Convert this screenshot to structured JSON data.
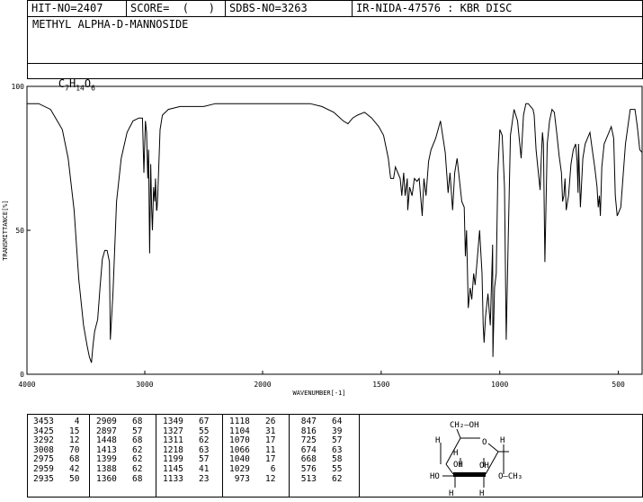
{
  "header": {
    "hit_no": "HIT-NO=2407",
    "score": "SCORE=  (   )",
    "sdbs_no": "SDBS-NO=3263",
    "ir_nida": "IR-NIDA-47576 : KBR DISC"
  },
  "compound_name": "METHYL ALPHA-D-MANNOSIDE",
  "formula": {
    "c": "C",
    "c_n": "7",
    "h": "H",
    "h_n": "14",
    "o": "O",
    "o_n": "6"
  },
  "chart_data": {
    "type": "line",
    "xlabel": "WAVENUMBER[-1]",
    "ylabel": "TRANSMITTANCE[%]",
    "xlim": [
      4000,
      400
    ],
    "ylim": [
      0,
      100
    ],
    "x_ticks": [
      4000,
      3000,
      2000,
      1500,
      1000,
      500
    ],
    "y_ticks": [
      0,
      50,
      100
    ],
    "x": [
      4000,
      3900,
      3800,
      3700,
      3650,
      3600,
      3560,
      3520,
      3490,
      3470,
      3453,
      3440,
      3425,
      3400,
      3380,
      3360,
      3340,
      3320,
      3300,
      3292,
      3270,
      3240,
      3200,
      3150,
      3100,
      3050,
      3020,
      3008,
      2995,
      2985,
      2975,
      2968,
      2959,
      2950,
      2942,
      2935,
      2925,
      2915,
      2909,
      2900,
      2897,
      2890,
      2870,
      2850,
      2800,
      2700,
      2600,
      2500,
      2400,
      2300,
      2200,
      2100,
      2000,
      1900,
      1800,
      1750,
      1700,
      1660,
      1640,
      1620,
      1600,
      1570,
      1540,
      1510,
      1490,
      1470,
      1460,
      1448,
      1440,
      1430,
      1420,
      1413,
      1405,
      1399,
      1390,
      1388,
      1380,
      1370,
      1360,
      1349,
      1340,
      1327,
      1320,
      1311,
      1300,
      1290,
      1270,
      1250,
      1230,
      1218,
      1210,
      1199,
      1190,
      1180,
      1160,
      1150,
      1145,
      1140,
      1133,
      1125,
      1118,
      1110,
      1104,
      1095,
      1085,
      1075,
      1070,
      1066,
      1060,
      1050,
      1040,
      1030,
      1029,
      1022,
      1015,
      1008,
      1000,
      990,
      980,
      973,
      965,
      955,
      940,
      925,
      910,
      900,
      890,
      880,
      870,
      860,
      855,
      847,
      840,
      830,
      825,
      820,
      816,
      810,
      800,
      790,
      780,
      770,
      760,
      750,
      740,
      735,
      730,
      725,
      720,
      710,
      700,
      690,
      680,
      674,
      670,
      668,
      660,
      650,
      640,
      630,
      620,
      610,
      600,
      590,
      585,
      580,
      576,
      570,
      560,
      540,
      530,
      520,
      513,
      505,
      490,
      470,
      450,
      430,
      420,
      410,
      400
    ],
    "y": [
      94,
      94,
      92,
      85,
      75,
      57,
      33,
      17,
      10,
      6,
      4,
      10,
      15,
      19,
      30,
      40,
      43,
      43,
      39,
      12,
      28,
      60,
      75,
      84,
      88,
      89,
      89,
      70,
      88,
      84,
      68,
      78,
      42,
      73,
      58,
      50,
      65,
      60,
      68,
      57,
      57,
      62,
      85,
      90,
      92,
      93,
      93,
      93,
      94,
      94,
      94,
      94,
      94,
      94,
      94,
      93,
      91,
      88,
      87,
      89,
      90,
      91,
      89,
      86,
      83,
      75,
      68,
      68,
      72,
      70,
      68,
      62,
      70,
      62,
      68,
      57,
      65,
      62,
      68,
      67,
      68,
      55,
      68,
      62,
      74,
      78,
      82,
      88,
      77,
      63,
      70,
      57,
      70,
      75,
      60,
      58,
      41,
      50,
      23,
      30,
      26,
      35,
      31,
      40,
      50,
      35,
      17,
      11,
      20,
      28,
      17,
      45,
      6,
      30,
      35,
      70,
      85,
      83,
      65,
      12,
      45,
      83,
      92,
      88,
      75,
      90,
      94,
      94,
      93,
      92,
      90,
      78,
      72,
      64,
      75,
      84,
      80,
      39,
      80,
      88,
      92,
      91,
      84,
      76,
      70,
      60,
      62,
      68,
      57,
      62,
      73,
      78,
      80,
      74,
      63,
      80,
      58,
      75,
      80,
      82,
      84,
      78,
      72,
      65,
      58,
      62,
      55,
      72,
      80,
      84,
      86,
      82,
      62,
      55,
      58,
      80,
      92,
      92,
      86,
      78,
      77,
      80,
      82
    ],
    "peaks": [
      [
        [
          3453,
          4
        ],
        [
          3425,
          15
        ],
        [
          3292,
          12
        ],
        [
          3008,
          70
        ],
        [
          2975,
          68
        ],
        [
          2959,
          42
        ],
        [
          2935,
          50
        ]
      ],
      [
        [
          2909,
          68
        ],
        [
          2897,
          57
        ],
        [
          1448,
          68
        ],
        [
          1413,
          62
        ],
        [
          1399,
          62
        ],
        [
          1388,
          62
        ],
        [
          1360,
          68
        ]
      ],
      [
        [
          1349,
          67
        ],
        [
          1327,
          55
        ],
        [
          1311,
          62
        ],
        [
          1218,
          63
        ],
        [
          1199,
          57
        ],
        [
          1145,
          41
        ],
        [
          1133,
          23
        ]
      ],
      [
        [
          1118,
          26
        ],
        [
          1104,
          31
        ],
        [
          1070,
          17
        ],
        [
          1066,
          11
        ],
        [
          1040,
          17
        ],
        [
          1029,
          6
        ],
        [
          973,
          12
        ]
      ],
      [
        [
          847,
          64
        ],
        [
          816,
          39
        ],
        [
          725,
          57
        ],
        [
          674,
          63
        ],
        [
          668,
          58
        ],
        [
          576,
          55
        ],
        [
          513,
          62
        ]
      ]
    ]
  },
  "structure": {
    "ch2oh": "CH₂—OH",
    "o_ring": "O",
    "h": "H",
    "oh": "OH",
    "ho": "HO",
    "och3": "O—CH₃"
  }
}
